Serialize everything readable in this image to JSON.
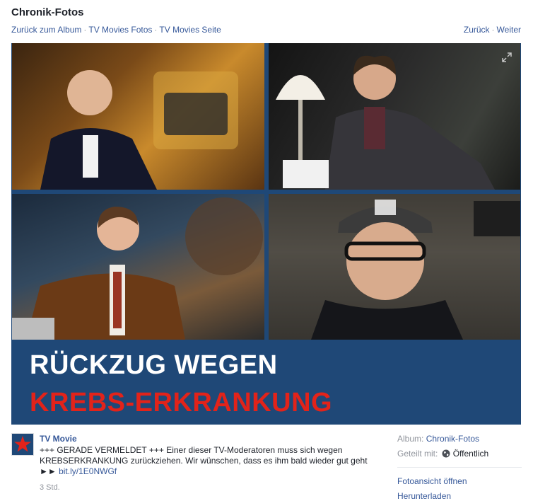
{
  "header": {
    "title": "Chronik-Fotos",
    "breadcrumb": [
      "Zurück zum Album",
      "TV Movies Fotos",
      "TV Movies Seite"
    ],
    "prev_label": "Zurück",
    "next_label": "Weiter"
  },
  "photo": {
    "headline_line1": "RÜCKZUG WEGEN",
    "headline_line2": "KREBS-ERKRANKUNG",
    "colors": {
      "banner": "#1f4877",
      "headline_white": "#ffffff",
      "headline_red": "#e2231a"
    }
  },
  "post": {
    "author": "TV Movie",
    "text_lines": [
      "+++ GERADE VERMELDET +++ Einer dieser TV-Moderatoren muss sich wegen",
      "KREBSERKRANKUNG zurückziehen. Wir wünschen, dass es ihm bald wieder gut geht"
    ],
    "link_prefix": "►► ",
    "link": "bit.ly/1E0NWGf",
    "time": "3 Std."
  },
  "sidebar": {
    "album_label": "Album:",
    "album_value": "Chronik-Fotos",
    "shared_label": "Geteilt mit:",
    "shared_value": "Öffentlich",
    "actions": [
      "Fotoansicht öffnen",
      "Herunterladen"
    ]
  },
  "colors": {
    "link": "#365899",
    "muted": "#90949c",
    "text": "#1d2129"
  },
  "icons": [
    "expand-icon",
    "globe-icon",
    "star-logo-icon"
  ]
}
